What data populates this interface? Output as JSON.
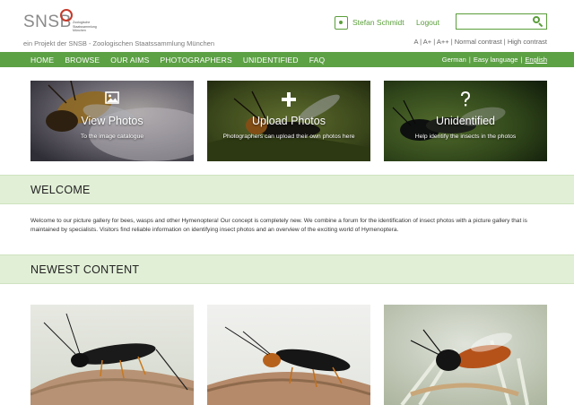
{
  "header": {
    "logo_text": "SNSB",
    "logo_subtext": "Zoologische Staatssammlung München",
    "tagline": "ein Projekt der SNSB - Zoologischen Staatssammlung München",
    "user_name": "Stefan Schmidt",
    "logout_label": "Logout",
    "search_placeholder": "",
    "accessibility": {
      "a": "A",
      "a_plus": "A+",
      "a_plusplus": "A++",
      "normal_contrast": "Normal contrast",
      "high_contrast": "High contrast"
    }
  },
  "nav": {
    "items": [
      "HOME",
      "BROWSE",
      "OUR AIMS",
      "PHOTOGRAPHERS",
      "UNIDENTIFIED",
      "FAQ"
    ],
    "languages": {
      "german": "German",
      "easy": "Easy language",
      "english": "English"
    }
  },
  "features": [
    {
      "title": "View Photos",
      "subtitle": "To the image catalogue",
      "icon": "image-icon"
    },
    {
      "title": "Upload Photos",
      "subtitle": "Photographers can upload their own photos here",
      "icon": "plus-icon"
    },
    {
      "title": "Unidentified",
      "subtitle": "Help identify the insects in the photos",
      "icon": "question-icon"
    }
  ],
  "welcome": {
    "heading": "WELCOME",
    "text": "Welcome to our picture gallery for bees, wasps and other Hymenoptera! Our concept is completely new. We combine a forum for the identification of insect photos with a picture gallery that is maintained by specialists. Visitors find reliable information on identifying insect photos and an overview of the exciting world of Hymenoptera."
  },
  "newest": {
    "heading": "NEWEST CONTENT"
  },
  "colors": {
    "brand_green": "#5da145",
    "band_green": "#e1efd6",
    "logo_red": "#c53a2a"
  }
}
